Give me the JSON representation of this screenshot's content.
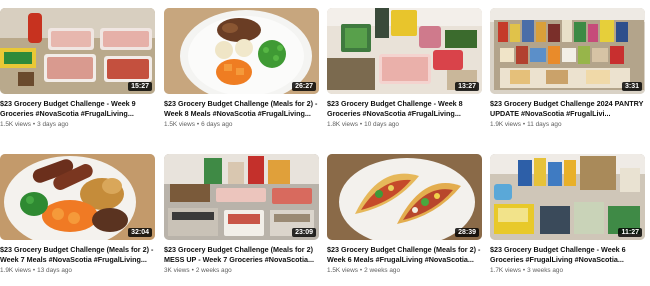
{
  "videos": [
    {
      "title": "$23 Grocery Budget Challenge - Week 9 Groceries #NovaScotia #FrugalLiving...",
      "duration": "15:27",
      "views": "1.5K views",
      "age": "3 days ago",
      "thumbnail_icon": "groceries-meat-trays-thumbnail"
    },
    {
      "title": "$23 Grocery Budget Challenge (Meals for 2) - Week 8 Meals #NovaScotia #FrugalLiving...",
      "duration": "26:27",
      "views": "1.5K views",
      "age": "6 days ago",
      "thumbnail_icon": "plate-meal-thumbnail"
    },
    {
      "title": "$23 Grocery Budget Challenge - Week 8 Groceries #NovaScotia #FrugalLiving...",
      "duration": "13:27",
      "views": "1.8K views",
      "age": "10 days ago",
      "thumbnail_icon": "groceries-table-thumbnail"
    },
    {
      "title": "$23 Grocery Budget Challenge 2024 PANTRY UPDATE #NovaScotia #FrugalLivi...",
      "duration": "3:31",
      "views": "1.9K views",
      "age": "11 days ago",
      "thumbnail_icon": "pantry-update-thumbnail"
    },
    {
      "title": "$23 Grocery Budget Challenge (Meals for 2) - Week 7 Meals #NovaScotia #FrugalLiving...",
      "duration": "32:04",
      "views": "1.9K views",
      "age": "13 days ago",
      "thumbnail_icon": "sausage-plate-thumbnail"
    },
    {
      "title": "$23 Grocery Budget Challenge (Meals for 2) MESS UP - Week 7 Groceries #NovaScotia...",
      "duration": "23:09",
      "views": "3K views",
      "age": "2 weeks ago",
      "thumbnail_icon": "groceries-counter-thumbnail"
    },
    {
      "title": "$23 Grocery Budget Challenge (Meals for 2) - Week 6 Meals #FrugalLiving #NovaScotia...",
      "duration": "28:39",
      "views": "1.5K views",
      "age": "2 weeks ago",
      "thumbnail_icon": "tacos-plate-thumbnail"
    },
    {
      "title": "$23 Grocery Budget Challenge - Week 6 Groceries #FrugalLiving #NovaScotia...",
      "duration": "11:27",
      "views": "1.7K views",
      "age": "3 weeks ago",
      "thumbnail_icon": "groceries-spread-thumbnail"
    }
  ],
  "meta_separator": "•"
}
